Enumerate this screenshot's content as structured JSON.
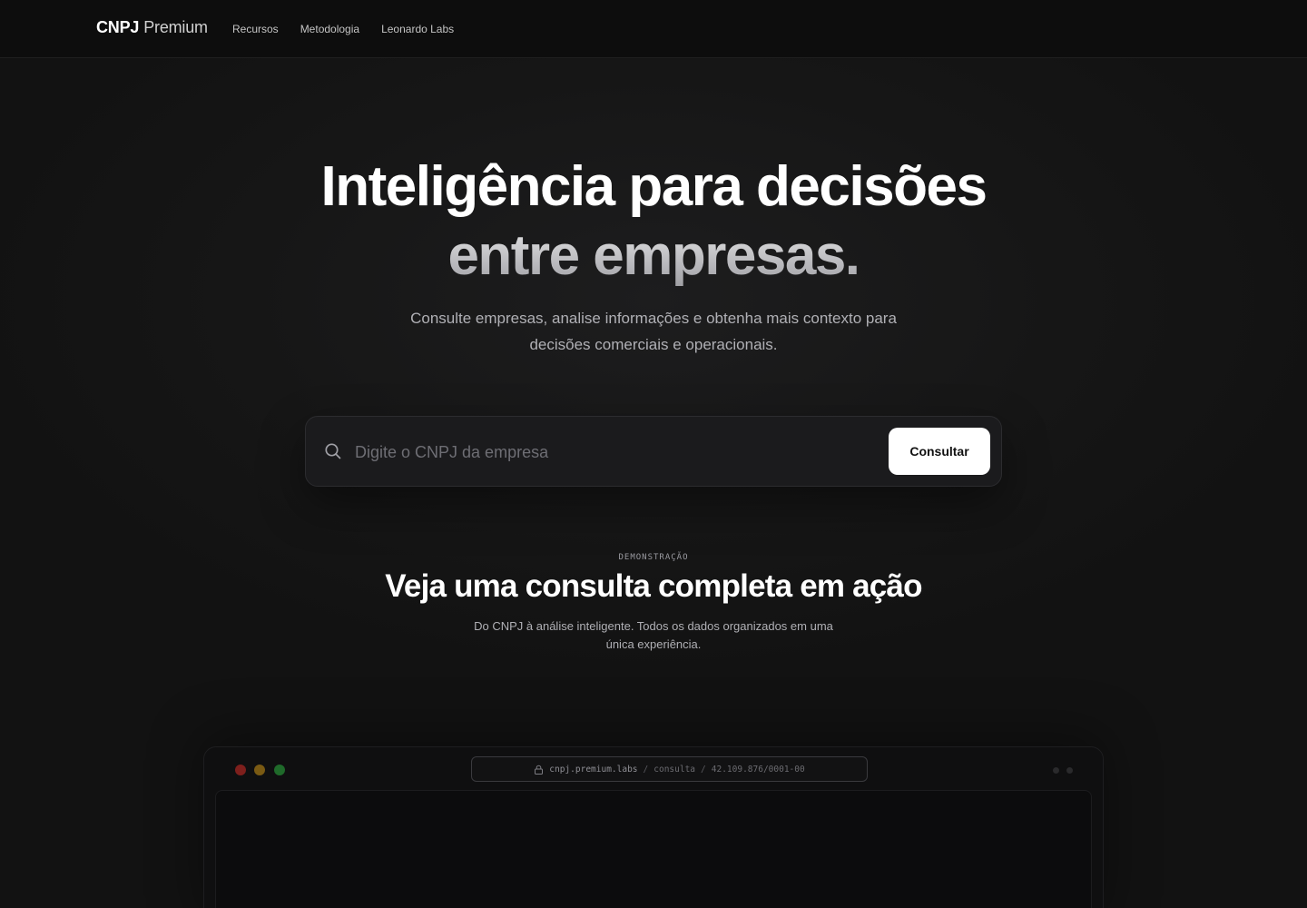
{
  "header": {
    "brand_strong": "CNPJ",
    "brand_light": "Premium",
    "nav": [
      {
        "label": "Recursos"
      },
      {
        "label": "Metodologia"
      },
      {
        "label": "Leonardo Labs"
      }
    ]
  },
  "hero": {
    "title_line1": "Inteligência para decisões",
    "title_line2": "entre empresas.",
    "subtitle_line1": "Consulte empresas, analise informações e obtenha mais contexto para",
    "subtitle_line2": "decisões comerciais e operacionais."
  },
  "search": {
    "icon": "search-icon",
    "placeholder": "Digite o CNPJ da empresa",
    "value": "",
    "button_label": "Consultar"
  },
  "demo": {
    "eyebrow": "DEMONSTRAÇÃO",
    "title": "Veja uma consulta completa em ação",
    "subtitle_line1": "Do CNPJ à análise inteligente. Todos os dados organizados em uma",
    "subtitle_line2": "única experiência."
  },
  "browser": {
    "url_host": "cnpj.premium.labs",
    "url_sep1": "/",
    "url_path1": "consulta",
    "url_sep2": "/",
    "url_path2": "42.109.876/0001-00",
    "lock_icon": "lock-icon"
  },
  "colors": {
    "background": "#141414",
    "header": "#0d0d0d",
    "button": "#ffffff",
    "dot_red": "#7e1f1c",
    "dot_yellow": "#7a5a13",
    "dot_green": "#1f6a2a"
  }
}
